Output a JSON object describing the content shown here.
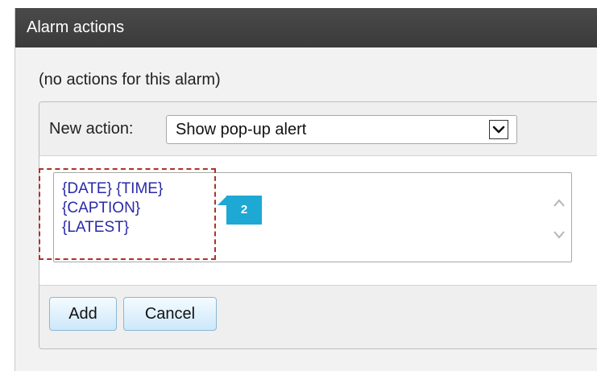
{
  "dialog": {
    "title": "Alarm actions",
    "status_text": "(no actions for this alarm)"
  },
  "new_action": {
    "label": "New action:",
    "selected": "Show pop-up alert",
    "arrow_icon": "chevron-down-icon"
  },
  "message": {
    "lines": [
      "{DATE} {TIME}",
      "{CAPTION}",
      "{LATEST}"
    ]
  },
  "callout": {
    "number": "2",
    "color": "#1ea8d4"
  },
  "buttons": {
    "add_label": "Add",
    "cancel_label": "Cancel"
  },
  "colors": {
    "titlebar": "#3f3f3f",
    "token_text": "#2a2aa8",
    "highlight": "#b0302a",
    "button_fill": "#cde8fb"
  }
}
